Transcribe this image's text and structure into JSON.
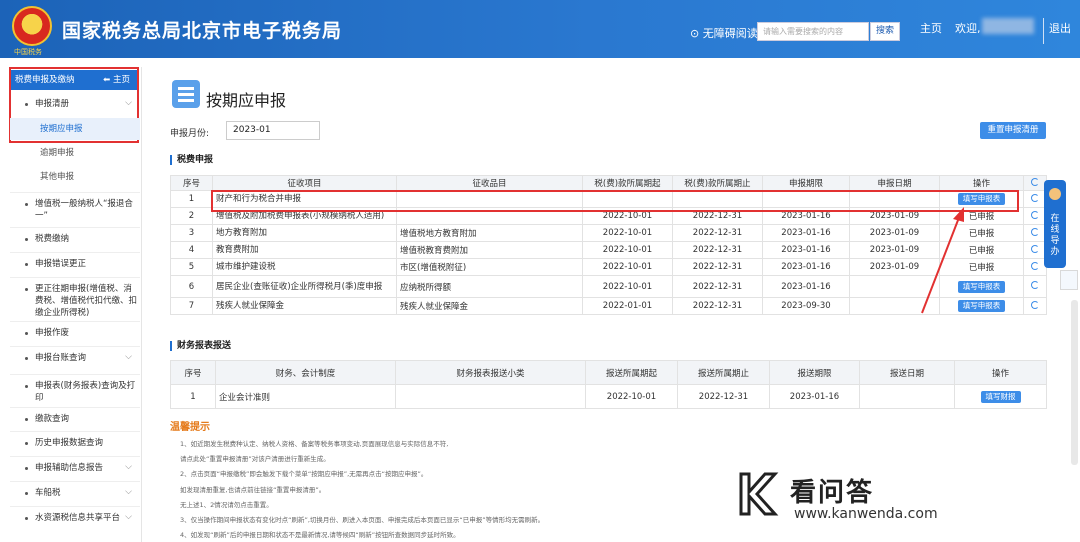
{
  "header": {
    "emblem_sub": "中国税务",
    "title": "国家税务总局北京市电子税务局",
    "accessibility": "⊙ 无障碍阅读",
    "search_placeholder": "请输入需要搜索的内容",
    "search_button": "搜索",
    "home": "主页",
    "welcome": "欢迎,",
    "logout": "退出"
  },
  "sidebar": {
    "head": "税费申报及缴纳",
    "home": "主页",
    "items": [
      {
        "label": "申报清册",
        "chev": true
      },
      {
        "label": "增值税一般纳税人“报退合一”",
        "chev": true
      },
      {
        "label": "税费缴纳",
        "chev": false
      },
      {
        "label": "申报错误更正",
        "chev": false
      },
      {
        "label": "更正往期申报(增值税、消费税、增值税代扣代缴、扣缴企业所得税)",
        "chev": false
      },
      {
        "label": "申报作废",
        "chev": false
      },
      {
        "label": "申报台账查询",
        "chev": true
      },
      {
        "label": "申报表(财务报表)查询及打印",
        "chev": true
      },
      {
        "label": "缴款查询",
        "chev": false
      },
      {
        "label": "历史申报数据查询",
        "chev": false
      },
      {
        "label": "申报辅助信息报告",
        "chev": true
      },
      {
        "label": "车船税",
        "chev": true
      },
      {
        "label": "水资源税信息共享平台",
        "chev": true
      }
    ],
    "subs": [
      "按期应申报",
      "逾期申报",
      "其他申报"
    ]
  },
  "page": {
    "title": "按期应申报",
    "month_label": "申报月份:",
    "month_value": "2023-01",
    "reset_button": "重置申报清册"
  },
  "tax_section": {
    "title": "税费申报",
    "headers": [
      "序号",
      "征收项目",
      "征收品目",
      "税(费)款所属期起",
      "税(费)款所属期止",
      "申报期限",
      "申报日期",
      "操作"
    ],
    "rows": [
      {
        "no": "1",
        "item": "财产和行为税合并申报",
        "sub": "",
        "from": "",
        "to": "",
        "deadline": "",
        "date": "",
        "op": "填写申报表",
        "op_button": true
      },
      {
        "no": "2",
        "item": "增值税及附加税费申报表(小规模纳税人适用)",
        "sub": "",
        "from": "2022-10-01",
        "to": "2022-12-31",
        "deadline": "2023-01-16",
        "date": "2023-01-09",
        "op": "已申报",
        "op_button": false
      },
      {
        "no": "3",
        "item": "地方教育附加",
        "sub": "增值税地方教育附加",
        "from": "2022-10-01",
        "to": "2022-12-31",
        "deadline": "2023-01-16",
        "date": "2023-01-09",
        "op": "已申报",
        "op_button": false
      },
      {
        "no": "4",
        "item": "教育费附加",
        "sub": "增值税教育费附加",
        "from": "2022-10-01",
        "to": "2022-12-31",
        "deadline": "2023-01-16",
        "date": "2023-01-09",
        "op": "已申报",
        "op_button": false
      },
      {
        "no": "5",
        "item": "城市维护建设税",
        "sub": "市区(增值税附征)",
        "from": "2022-10-01",
        "to": "2022-12-31",
        "deadline": "2023-01-16",
        "date": "2023-01-09",
        "op": "已申报",
        "op_button": false
      },
      {
        "no": "6",
        "item": "居民企业(查账征收)企业所得税月(季)度申报",
        "sub": "应纳税所得额",
        "from": "2022-10-01",
        "to": "2022-12-31",
        "deadline": "2023-01-16",
        "date": "",
        "op": "填写申报表",
        "op_button": true
      },
      {
        "no": "7",
        "item": "残疾人就业保障金",
        "sub": "残疾人就业保障金",
        "from": "2022-01-01",
        "to": "2022-12-31",
        "deadline": "2023-09-30",
        "date": "",
        "op": "填写申报表",
        "op_button": true
      }
    ]
  },
  "fin_section": {
    "title": "财务报表报送",
    "headers": [
      "序号",
      "财务、会计制度",
      "财务报表报送小类",
      "报送所属期起",
      "报送所属期止",
      "报送期限",
      "报送日期",
      "操作"
    ],
    "rows": [
      {
        "no": "1",
        "system": "企业会计准则",
        "subtype": "",
        "from": "2022-10-01",
        "to": "2022-12-31",
        "deadline": "2023-01-16",
        "date": "",
        "op": "填写财报"
      }
    ]
  },
  "tips": {
    "title": "温馨提示",
    "lines": [
      "1、如近期发生税费种认定、纳税人资格、备案等税务事项变动,页面展现信息与实际信息不符,",
      "请点此处“重置申报清册”对该户清册进行重新生成。",
      "2、点击页面“申报缴税”即会触发下载个菜单“按期应申报”,无需再点击“按期应申报”。",
      "如发现清册重复,也请点前往链接“重置申报清册”。",
      "无上述1、2情况请勿点击重置。",
      "3、仅当操作期间申报状态有变化时点“刷新”,切换月份、刷进入本页面、申报完成后本页面已显示“已申报”等情形均无需刷新。",
      "4、如发现“刷新”后的申报日期和状态不是最新情况,请等候四“刷新”按钮所查数据同步延时所致。"
    ]
  },
  "float": {
    "label": "在线导办"
  },
  "watermark": {
    "text": "看问答",
    "url": "www.kanwenda.com"
  }
}
